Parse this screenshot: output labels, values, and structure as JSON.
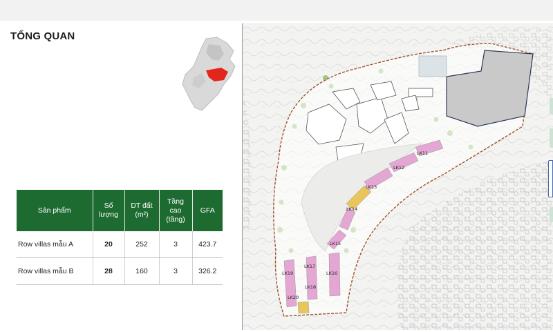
{
  "header": {
    "title": "TỔNG QUAN"
  },
  "table": {
    "headers": [
      {
        "line1": "Sản phẩm",
        "line2": ""
      },
      {
        "line1": "Số lượng",
        "line2": ""
      },
      {
        "line1": "DT đất",
        "line2": "(m²)"
      },
      {
        "line1": "Tầng cao",
        "line2": "(tầng)"
      },
      {
        "line1": "GFA",
        "line2": ""
      }
    ],
    "rows": [
      {
        "product": "Row villas mẫu A",
        "quantity": "20",
        "land_area": "252",
        "floors": "3",
        "gfa": "423.7"
      },
      {
        "product": "Row villas mẫu B",
        "quantity": "28",
        "land_area": "160",
        "floors": "3",
        "gfa": "326.2"
      }
    ]
  },
  "map": {
    "lot_labels": [
      "LK11",
      "LK12",
      "LK13",
      "LK14",
      "LK15",
      "LK16",
      "LK17",
      "LK18",
      "LK19",
      "LK20"
    ]
  },
  "colors": {
    "table_header_bg": "#1e6b31",
    "villa_pink": "#e4a6d2",
    "villa_yellow": "#e8c65c",
    "boundary": "#a0522d",
    "highlight_red": "#e2261c"
  }
}
